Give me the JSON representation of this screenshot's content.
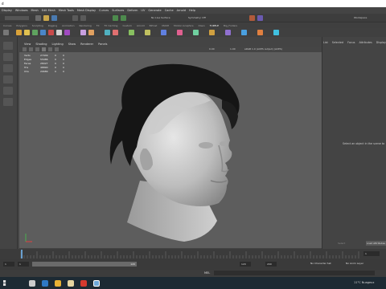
{
  "titlebar": {
    "title": "d"
  },
  "menubar": {
    "items": [
      "Display",
      "Windows",
      "Mesh",
      "Edit Mesh",
      "Mesh Tools",
      "Mesh Display",
      "Curves",
      "Surfaces",
      "Deform",
      "UV",
      "Generate",
      "Cache",
      "Arnold",
      "Help"
    ]
  },
  "status": {
    "no_live_surface": "No Live Surface",
    "symmetry": "Symmetry: Off",
    "workspace": "Workspace"
  },
  "shelf_tabs": [
    "Curves",
    "Polygons",
    "Sculpting",
    "Rigging",
    "Animation",
    "Rendering",
    "FX",
    "FX Caching",
    "Custom",
    "Arnold",
    "Bifrost",
    "MASH",
    "Motion Graphics",
    "XGen",
    "TURTLE",
    "Big_Folders"
  ],
  "viewport": {
    "menu": [
      "View",
      "Shading",
      "Lighting",
      "Show",
      "Renderer",
      "Panels"
    ],
    "toolbar_values": {
      "near": "0.00",
      "far": "1.00",
      "colorspace": "sRGB 1.0 (ACES output) (ACES)"
    },
    "hud": [
      {
        "label": "Verts",
        "a": "27949",
        "b": "0",
        "c": "0"
      },
      {
        "label": "Edges",
        "a": "55986",
        "b": "0",
        "c": "0"
      },
      {
        "label": "Faces",
        "a": "28027",
        "b": "0",
        "c": "0"
      },
      {
        "label": "Tris",
        "a": "48890",
        "b": "0",
        "c": "0"
      },
      {
        "label": "UVs",
        "a": "29689",
        "b": "0",
        "c": "0"
      }
    ]
  },
  "right_panel": {
    "tabs": [
      "List",
      "Selected",
      "Focus",
      "Attributes",
      "Display"
    ],
    "message": "Select an object in the scene to",
    "btn_select": "Select",
    "btn_load": "Load Attributes"
  },
  "timeline": {
    "current": "1",
    "start": "1",
    "end": "120",
    "range_start": "1",
    "range_end": "120",
    "range_end2": "200",
    "character_set": "No Character Set",
    "anim_layer": "No Anim Layer",
    "fps": "24 fps"
  },
  "command": {
    "label": "MEL"
  },
  "taskbar": {
    "weather": "11°C  Nuageux",
    "time": "20:54"
  },
  "colors": {
    "maya_bg": "#444444",
    "viewport": "#5d5d5d",
    "taskbar": "#1d2a33",
    "accent": "#5285a6"
  }
}
